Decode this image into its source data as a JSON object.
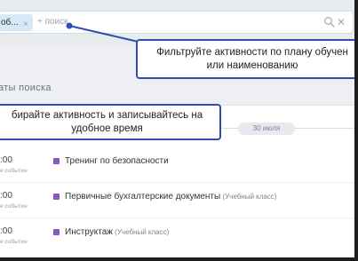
{
  "search": {
    "chip_text": "об...",
    "chip_close": "×",
    "add_label": "+ поиск",
    "clear_glyph": "✕"
  },
  "tooltips": {
    "filter_line1": "Фильтруйте активности по плану обучен",
    "filter_line2": "или наименованию",
    "book_line1": "бирайте активность и записывайтесь на",
    "book_line2": "удобное время"
  },
  "results": {
    "label": "аты поиска",
    "date_pill": "30 июля"
  },
  "rows": [
    {
      "time": ":00",
      "sub": "е событие",
      "title": "Тренинг по безопасности",
      "tag": ""
    },
    {
      "time": ":00",
      "sub": "е событие",
      "title": "Первичные бухгалтерские документы",
      "tag": " (Учебный класс)"
    },
    {
      "time": ":00",
      "sub": "е событие",
      "title": "Инструктаж",
      "tag": " (Учебный класс)"
    }
  ],
  "colors": {
    "accent": "#2f4eb1",
    "marker": "#8a56c2",
    "chip_bg": "#d6e9f6"
  }
}
